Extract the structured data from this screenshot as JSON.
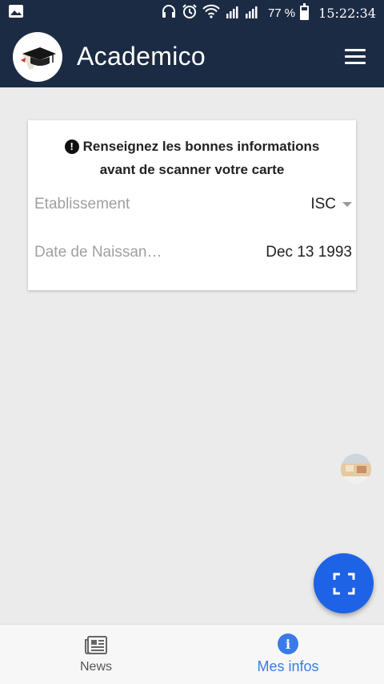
{
  "status_bar": {
    "battery_percent": "77 %",
    "time": "15:22:34",
    "icons": [
      "image-icon",
      "headphones-icon",
      "alarm-icon",
      "wifi-icon",
      "signal-icon",
      "battery-icon"
    ]
  },
  "app_bar": {
    "title": "Academico",
    "logo_icon": "graduation-cap-icon",
    "menu_icon": "hamburger-menu-icon",
    "background": "#1c2b44"
  },
  "card": {
    "notice_line1": "Renseignez les bonnes informations",
    "notice_line2": "avant de scanner votre carte",
    "etablissement_label": "Etablissement",
    "etablissement_value": "ISC",
    "date_label": "Date de Naissan…",
    "date_value": "Dec 13 1993"
  },
  "fab": {
    "icon": "scan-icon",
    "color": "#1e63e6"
  },
  "bottom_nav": {
    "items": [
      {
        "label": "News",
        "icon": "newspaper-icon",
        "active": false
      },
      {
        "label": "Mes infos",
        "icon": "info-icon",
        "active": true
      }
    ],
    "active_color": "#3a7be8"
  }
}
